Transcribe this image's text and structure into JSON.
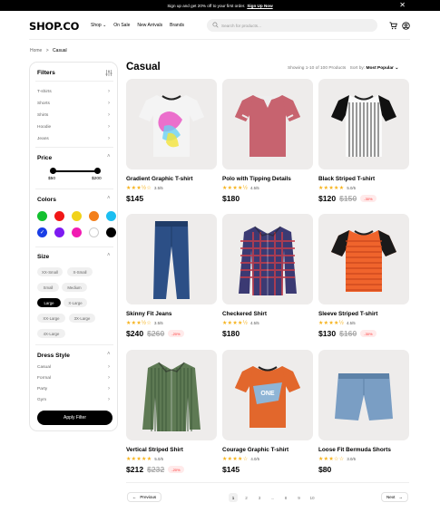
{
  "announcement": {
    "text": "Sign up and get 20% off to your first order.",
    "link": "Sign Up Now",
    "close": "✕"
  },
  "header": {
    "logo": "SHOP.CO",
    "nav": [
      "Shop",
      "On Sale",
      "New Arrivals",
      "Brands"
    ],
    "search_placeholder": "Search for products..."
  },
  "breadcrumb": {
    "home": "Home",
    "sep": ">",
    "current": "Casual"
  },
  "filters": {
    "title": "Filters",
    "categories": [
      "T-shirts",
      "Shorts",
      "Shirts",
      "Hoodie",
      "Jeans"
    ],
    "price": {
      "title": "Price",
      "min": "$50",
      "max": "$200"
    },
    "colors": {
      "title": "Colors",
      "swatches": [
        "#13c02f",
        "#f11717",
        "#f1d21a",
        "#f37f1b",
        "#1bbef1",
        "#1a3ee6",
        "#7d1bf1",
        "#f11bb2",
        "#ffffff",
        "#000000"
      ],
      "selected_index": 5
    },
    "size": {
      "title": "Size",
      "options": [
        "XX-Small",
        "X-Small",
        "Small",
        "Medium",
        "Large",
        "X-Large",
        "XX-Large",
        "3X-Large",
        "4X-Large"
      ],
      "selected": "Large"
    },
    "dress": {
      "title": "Dress Style",
      "styles": [
        "Casual",
        "Formal",
        "Party",
        "Gym"
      ]
    },
    "apply": "Apply Filter"
  },
  "main": {
    "title": "Casual",
    "showing": "Showing 1-10 of 100 Products",
    "sort_label": "Sort by:",
    "sort_value": "Most Popular",
    "products": [
      {
        "name": "Gradient Graphic T-shirt",
        "stars": "★★★½☆",
        "rating": "3.5/5",
        "price": "$145",
        "old": "",
        "disc": ""
      },
      {
        "name": "Polo with Tipping Details",
        "stars": "★★★★½",
        "rating": "4.5/5",
        "price": "$180",
        "old": "",
        "disc": ""
      },
      {
        "name": "Black Striped T-shirt",
        "stars": "★★★★★",
        "rating": "5.0/5",
        "price": "$120",
        "old": "$150",
        "disc": "-30%"
      },
      {
        "name": "Skinny Fit Jeans",
        "stars": "★★★½☆",
        "rating": "3.5/5",
        "price": "$240",
        "old": "$260",
        "disc": "-20%"
      },
      {
        "name": "Checkered Shirt",
        "stars": "★★★★½",
        "rating": "4.5/5",
        "price": "$180",
        "old": "",
        "disc": ""
      },
      {
        "name": "Sleeve Striped T-shirt",
        "stars": "★★★★½",
        "rating": "4.5/5",
        "price": "$130",
        "old": "$160",
        "disc": "-30%"
      },
      {
        "name": "Vertical Striped Shirt",
        "stars": "★★★★★",
        "rating": "5.0/5",
        "price": "$212",
        "old": "$232",
        "disc": "-20%"
      },
      {
        "name": "Courage Graphic T-shirt",
        "stars": "★★★★☆",
        "rating": "4.0/5",
        "price": "$145",
        "old": "",
        "disc": ""
      },
      {
        "name": "Loose Fit Bermuda Shorts",
        "stars": "★★★☆☆",
        "rating": "3.0/5",
        "price": "$80",
        "old": "",
        "disc": ""
      }
    ]
  },
  "pagination": {
    "prev": "Previous",
    "next": "Next",
    "pages": [
      "1",
      "2",
      "3",
      "...",
      "8",
      "9",
      "10"
    ],
    "current": "1"
  }
}
